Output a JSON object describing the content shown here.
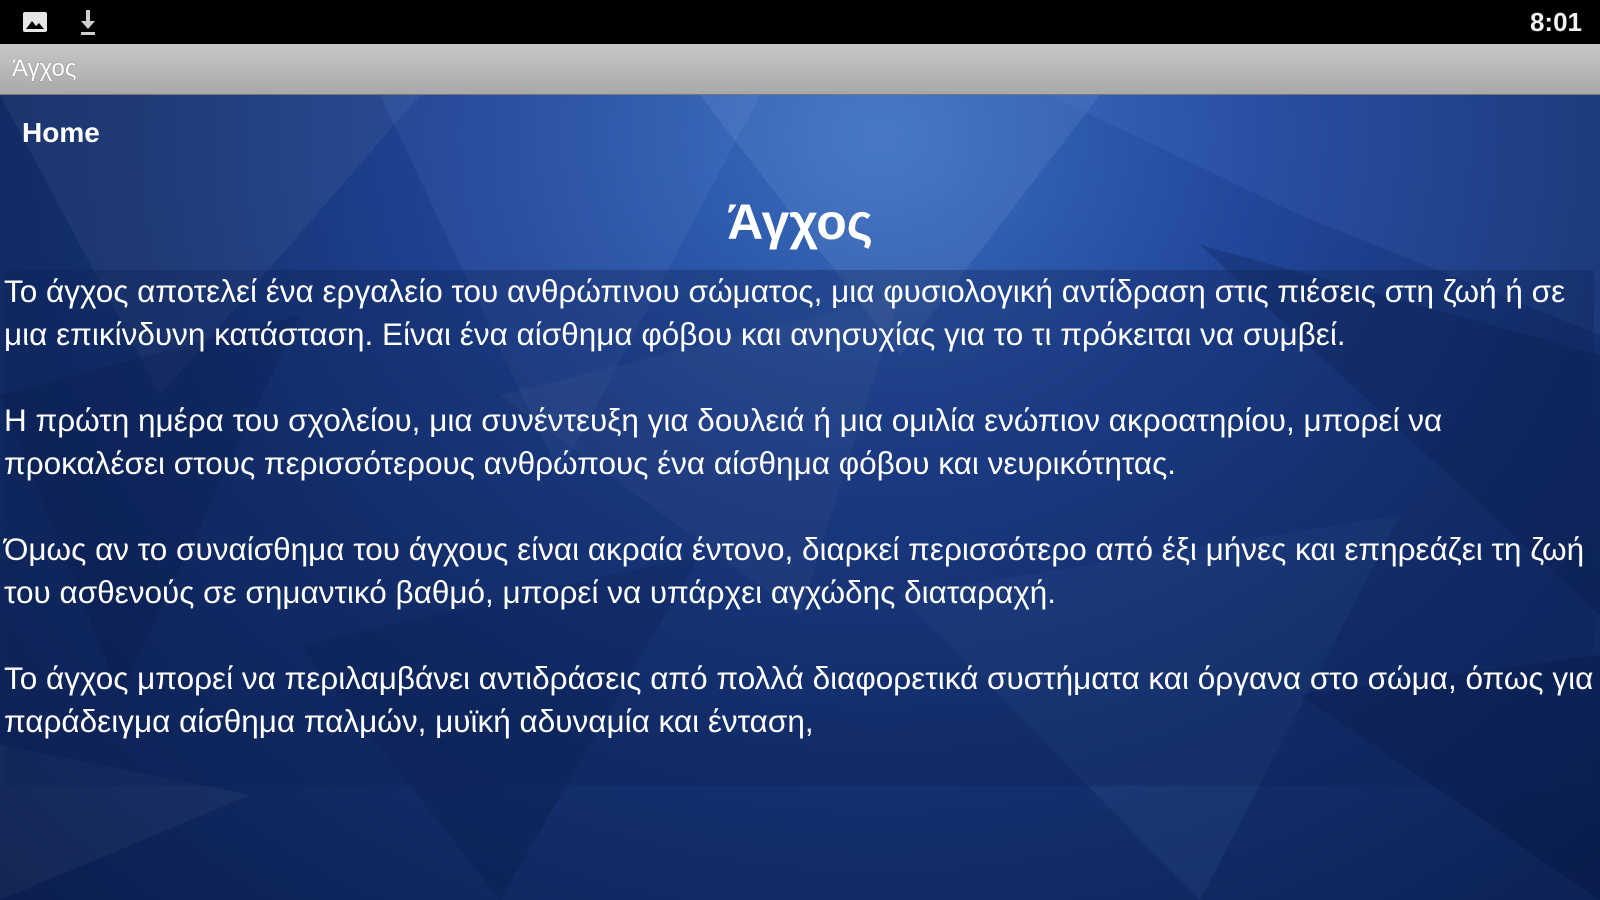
{
  "status_bar": {
    "time": "8:01",
    "icons": [
      "image-icon",
      "download-icon"
    ]
  },
  "action_bar": {
    "title": "Άγχος"
  },
  "nav": {
    "home_label": "Home"
  },
  "page": {
    "title": "Άγχος",
    "paragraphs": [
      "Το άγχος αποτελεί ένα εργαλείο του ανθρώπινου σώματος, μια φυσιολογική αντίδραση στις πιέσεις στη ζωή ή σε μια επικίνδυνη κατάσταση. Είναι ένα αίσθημα φόβου και ανησυχίας για το τι πρόκειται να συμβεί.",
      "Η πρώτη ημέρα του σχολείου, μια συνέντευξη για δουλειά ή μια ομιλία ενώπιον ακροατηρίου, μπορεί να προκαλέσει στους περισσότερους ανθρώπους ένα αίσθημα φόβου και νευρικότητας.",
      "Όμως αν το συναίσθημα του άγχους είναι ακραία έντονο, διαρκεί περισσότερο από έξι μήνες και επηρεάζει τη ζωή του ασθενούς σε σημαντικό βαθμό, μπορεί να υπάρχει αγχώδης διαταραχή.",
      "Το άγχος μπορεί να περιλαμβάνει αντιδράσεις από πολλά διαφορετικά συστήματα και όργανα στο σώμα, όπως για παράδειγμα αίσθημα παλμών, μυϊκή αδυναμία και ένταση,"
    ]
  },
  "colors": {
    "status_bar_bg": "#000000",
    "action_bar_bg": "#b8b8b8",
    "content_bg": "#1b3a82",
    "text": "#ffffff"
  }
}
